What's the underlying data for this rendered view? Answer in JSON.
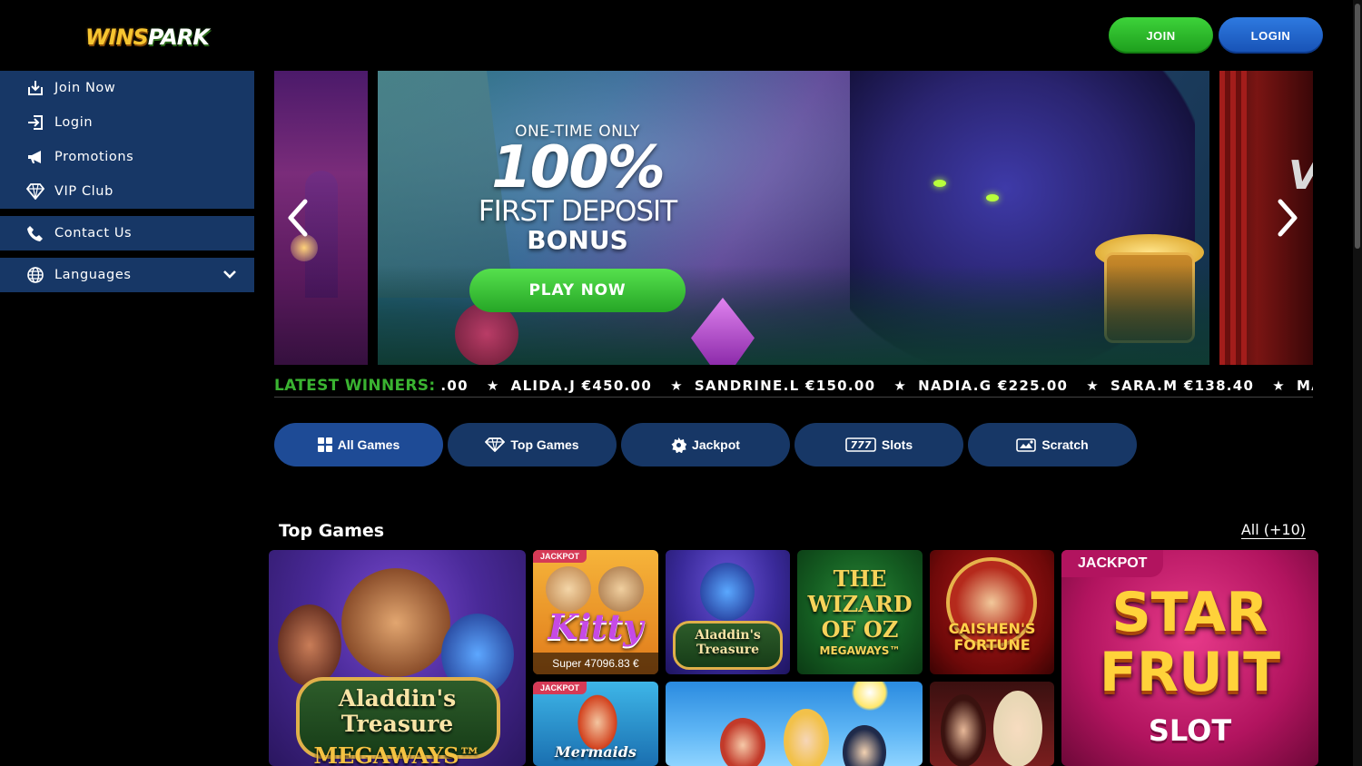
{
  "header": {
    "logo_text_a": "WINS",
    "logo_text_b": "PARK",
    "join_label": "JOIN",
    "login_label": "LOGIN"
  },
  "sidebar": {
    "items": [
      {
        "label": "Join Now",
        "icon": "join-icon"
      },
      {
        "label": "Login",
        "icon": "login-icon"
      },
      {
        "label": "Promotions",
        "icon": "megaphone-icon"
      },
      {
        "label": "VIP Club",
        "icon": "diamond-icon"
      }
    ],
    "contact_label": "Contact Us",
    "languages_label": "Languages"
  },
  "banner": {
    "line1": "ONE-TIME ONLY",
    "line2": "100%",
    "line3": "FIRST DEPOSIT",
    "line4": "BONUS",
    "cta": "PLAY NOW",
    "next_slide_letter": "V"
  },
  "ticker": {
    "label": "LATEST WINNERS:",
    "lead": ".00",
    "entries": [
      {
        "name": "ALIDA.J",
        "amount": "€450.00"
      },
      {
        "name": "SANDRINE.L",
        "amount": "€150.00"
      },
      {
        "name": "NADIA.G",
        "amount": "€225.00"
      },
      {
        "name": "SARA.M",
        "amount": "€138.40"
      },
      {
        "name": "MARIA.D",
        "amount": ""
      }
    ]
  },
  "tabs": [
    {
      "label": "All Games",
      "icon": "grid-icon",
      "active": true
    },
    {
      "label": "Top Games",
      "icon": "diamond-icon",
      "active": false
    },
    {
      "label": "Jackpot",
      "icon": "gear-icon",
      "active": false
    },
    {
      "label": "Slots",
      "icon": "slots-777-icon",
      "active": false
    },
    {
      "label": "Scratch",
      "icon": "scratch-card-icon",
      "active": false
    }
  ],
  "games_section": {
    "title": "Top Games",
    "all_link": "All (+10)",
    "games": [
      {
        "title": "Aladdin's Treasure",
        "subtitle": "MEGAWAYS™"
      },
      {
        "title": "Kitty",
        "jackpot_tag": "JACKPOT",
        "jackpot_value": "Super 47096.83 €"
      },
      {
        "title": "Aladdin's Treasure"
      },
      {
        "title": "THE WIZARD OF OZ",
        "subtitle": "MEGAWAYS™"
      },
      {
        "title": "CAISHEN'S FORTUNE"
      },
      {
        "title": "STAR FRUIT",
        "subtitle": "SLOT",
        "jackpot_tag": "JACKPOT"
      },
      {
        "title": "Mermaids",
        "jackpot_tag": "JACKPOT"
      }
    ]
  },
  "colors": {
    "sidebar_bg": "#173766",
    "tab_active": "#1e4b96",
    "join_green": "#2bb92a",
    "login_blue": "#1f66cc",
    "winners_green": "#3ab331"
  }
}
